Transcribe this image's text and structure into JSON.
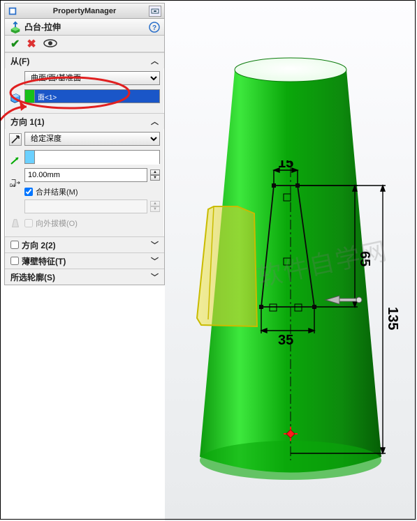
{
  "title": "PropertyManager",
  "feature_name": "凸台-拉伸",
  "sections": {
    "from": {
      "label": "从(F)",
      "dropdown": "曲面/面/基准面",
      "face_selection": "面<1>"
    },
    "dir1": {
      "label": "方向 1(1)",
      "end_condition": "给定深度",
      "blank_value": "",
      "depth": "10.00mm",
      "merge_label": "合并结果(M)",
      "merge_checked": true,
      "draft_value": "",
      "draft_outward_label": "向外拔模(O)",
      "draft_outward_checked": false
    },
    "dir2": {
      "label": "方向 2(2)",
      "checked": false
    },
    "thin": {
      "label": "薄壁特征(T)",
      "checked": false
    },
    "contour": {
      "label": "所选轮廓(S)"
    }
  },
  "sketch": {
    "dim_top": "15",
    "dim_bottom": "35",
    "dim_side": "65",
    "dim_overall": "135"
  }
}
